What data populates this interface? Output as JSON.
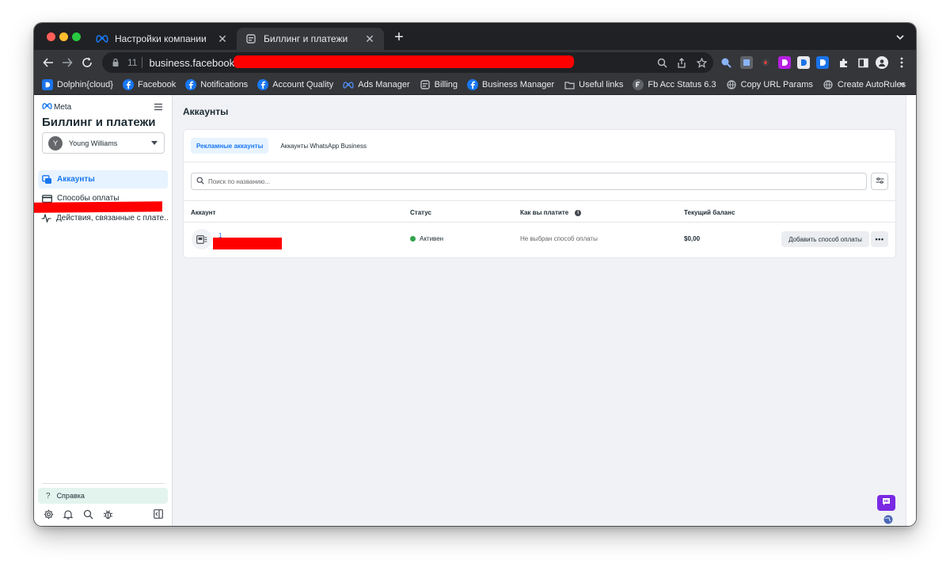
{
  "browser": {
    "tabs": [
      {
        "title": "Настройки компании",
        "active": false
      },
      {
        "title": "Биллинг и платежи",
        "active": true
      }
    ],
    "address": {
      "tab_count": "11",
      "url": "business.facebook.com"
    },
    "bookmarks": [
      {
        "label": "Dolphin{cloud}",
        "icon": "dolphin-icon"
      },
      {
        "label": "Facebook",
        "icon": "facebook-icon"
      },
      {
        "label": "Notifications",
        "icon": "facebook-icon"
      },
      {
        "label": "Account Quality",
        "icon": "facebook-icon"
      },
      {
        "label": "Ads Manager",
        "icon": "meta-icon"
      },
      {
        "label": "Billing",
        "icon": "billing-icon"
      },
      {
        "label": "Business Manager",
        "icon": "facebook-icon"
      },
      {
        "label": "Useful links",
        "icon": "folder-icon"
      },
      {
        "label": "Fb Acc Status 6.3",
        "icon": "fb-status-icon"
      },
      {
        "label": "Copy URL Params",
        "icon": "globe-icon"
      },
      {
        "label": "Create AutoRules",
        "icon": "globe-icon"
      }
    ],
    "bookmarks_more": "»"
  },
  "sidebar": {
    "logo_text": "Meta",
    "title": "Биллинг и платежи",
    "account": {
      "initial": "Y",
      "name": "Young Williams"
    },
    "nav": [
      {
        "label": "Аккаунты",
        "icon": "accounts-icon",
        "selected": true
      },
      {
        "label": "Способы оплаты",
        "icon": "credit-card-icon",
        "selected": false
      },
      {
        "label": "Действия, связанные с плате...",
        "icon": "activity-icon",
        "selected": false
      }
    ],
    "help_label": "Справка",
    "help_icon": "?"
  },
  "main": {
    "title": "Аккаунты",
    "tabs": [
      {
        "label": "Рекламные аккаунты",
        "active": true
      },
      {
        "label": "Аккаунты WhatsApp Business",
        "active": false
      }
    ],
    "search_placeholder": "Поиск по названию...",
    "columns": [
      "Аккаунт",
      "Статус",
      "Как вы платите",
      "Текущий баланс"
    ],
    "info_glyph": "i",
    "rows": [
      {
        "account_id": "1",
        "status": "Активен",
        "payment": "Не выбран способ оплаты",
        "balance": "$0,00",
        "action": "Добавить способ оплаты",
        "more": "•••"
      }
    ]
  },
  "colors": {
    "accent": "#1877f2",
    "status_active": "#31a24c",
    "redaction": "#ff0000",
    "chat": "#7a2ae3"
  }
}
